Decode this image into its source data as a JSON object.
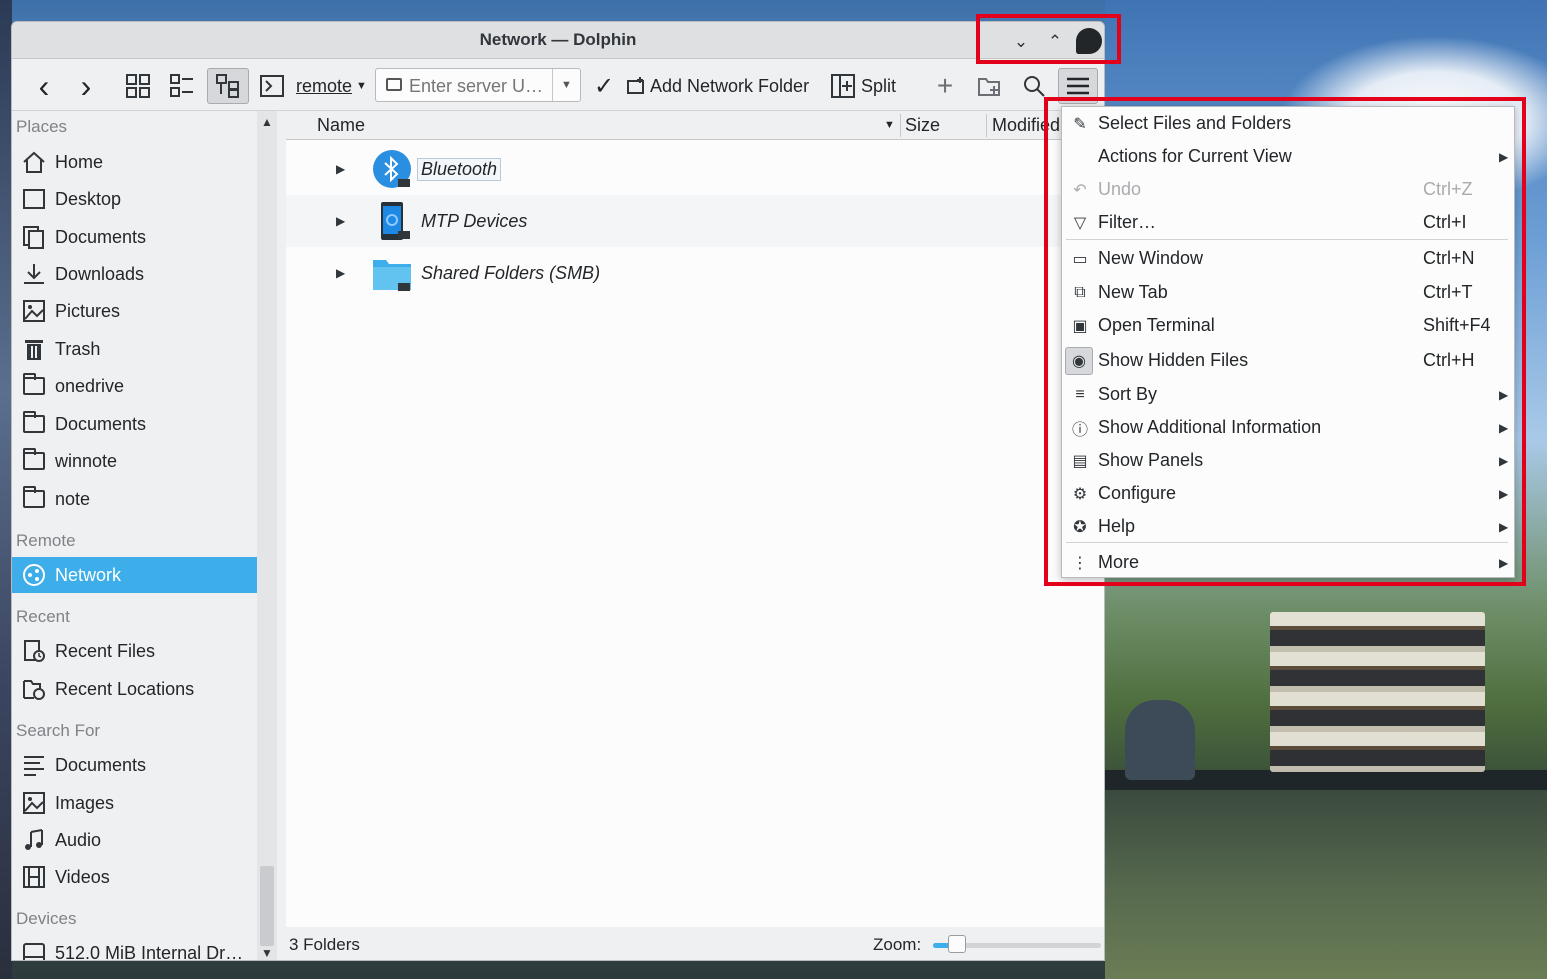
{
  "window": {
    "title": "Network — Dolphin",
    "controls": {
      "minimize": "⌄",
      "maximize": "⌃"
    }
  },
  "toolbar": {
    "back_icon": "‹",
    "forward_icon": "›",
    "remote_label": "remote",
    "server_placeholder": "Enter server U…",
    "add_network_folder_label": "Add Network Folder",
    "split_label": "Split"
  },
  "sidebar": {
    "sections": {
      "places": "Places",
      "remote": "Remote",
      "recent": "Recent",
      "search": "Search For",
      "devices": "Devices"
    },
    "places": [
      "Home",
      "Desktop",
      "Documents",
      "Downloads",
      "Pictures",
      "Trash",
      "onedrive",
      "Documents",
      "winnote",
      "note"
    ],
    "remote": [
      "Network"
    ],
    "recent": [
      "Recent Files",
      "Recent Locations"
    ],
    "search": [
      "Documents",
      "Images",
      "Audio",
      "Videos"
    ],
    "devices": [
      "512.0 MiB Internal Dr…"
    ]
  },
  "columns": {
    "name": "Name",
    "size": "Size",
    "modified": "Modified"
  },
  "rows": [
    {
      "name": "Bluetooth"
    },
    {
      "name": "MTP Devices"
    },
    {
      "name": "Shared Folders (SMB)"
    }
  ],
  "status": {
    "count": "3 Folders",
    "zoom_label": "Zoom:",
    "zoom_fraction": 0.13
  },
  "menu": {
    "items": [
      {
        "label": "Select Files and Folders",
        "shortcut": "",
        "submenu": false,
        "icon": "select-icon"
      },
      {
        "label": "Actions for Current View",
        "shortcut": "",
        "submenu": true,
        "icon": ""
      },
      {
        "label": "Undo",
        "shortcut": "Ctrl+Z",
        "submenu": false,
        "icon": "undo-icon",
        "disabled": true
      },
      {
        "label": "Filter…",
        "shortcut": "Ctrl+I",
        "submenu": false,
        "icon": "filter-icon"
      },
      {
        "label": "New Window",
        "shortcut": "Ctrl+N",
        "submenu": false,
        "icon": "new-window-icon"
      },
      {
        "label": "New Tab",
        "shortcut": "Ctrl+T",
        "submenu": false,
        "icon": "new-tab-icon"
      },
      {
        "label": "Open Terminal",
        "shortcut": "Shift+F4",
        "submenu": false,
        "icon": "terminal-icon"
      },
      {
        "label": "Show Hidden Files",
        "shortcut": "Ctrl+H",
        "submenu": false,
        "icon": "eye-icon",
        "checked": true
      },
      {
        "label": "Sort By",
        "shortcut": "",
        "submenu": true,
        "icon": "sort-icon"
      },
      {
        "label": "Show Additional Information",
        "shortcut": "",
        "submenu": true,
        "icon": "info-icon"
      },
      {
        "label": "Show Panels",
        "shortcut": "",
        "submenu": true,
        "icon": "panels-icon"
      },
      {
        "label": "Configure",
        "shortcut": "",
        "submenu": true,
        "icon": "configure-icon"
      },
      {
        "label": "Help",
        "shortcut": "",
        "submenu": true,
        "icon": "help-icon"
      },
      {
        "label": "More",
        "shortcut": "",
        "submenu": true,
        "icon": "more-icon"
      }
    ]
  },
  "colors": {
    "accent": "#3daee9",
    "annotation": "#e2001a"
  }
}
